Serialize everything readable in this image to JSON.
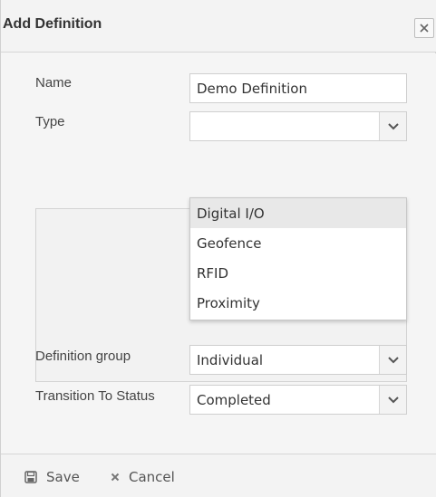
{
  "dialog": {
    "title": "Add Definition",
    "close_icon": "close-icon"
  },
  "form": {
    "name_label": "Name",
    "name_value": "Demo Definition",
    "type_label": "Type",
    "type_value": "",
    "type_options": [
      "Digital I/O",
      "Geofence",
      "RFID",
      "Proximity"
    ],
    "type_highlighted": "Digital I/O",
    "definition_group_label": "Definition group",
    "definition_group_value": "Individual",
    "transition_label": "Transition To Status",
    "transition_value": "Completed"
  },
  "footer": {
    "save_label": "Save",
    "save_icon": "save-icon",
    "cancel_label": "Cancel",
    "cancel_icon": "cancel-icon"
  },
  "colors": {
    "dialog_bg": "#f5f5f5",
    "border": "#cfcfcf",
    "highlight": "#e8e8e8",
    "text": "#333333"
  }
}
